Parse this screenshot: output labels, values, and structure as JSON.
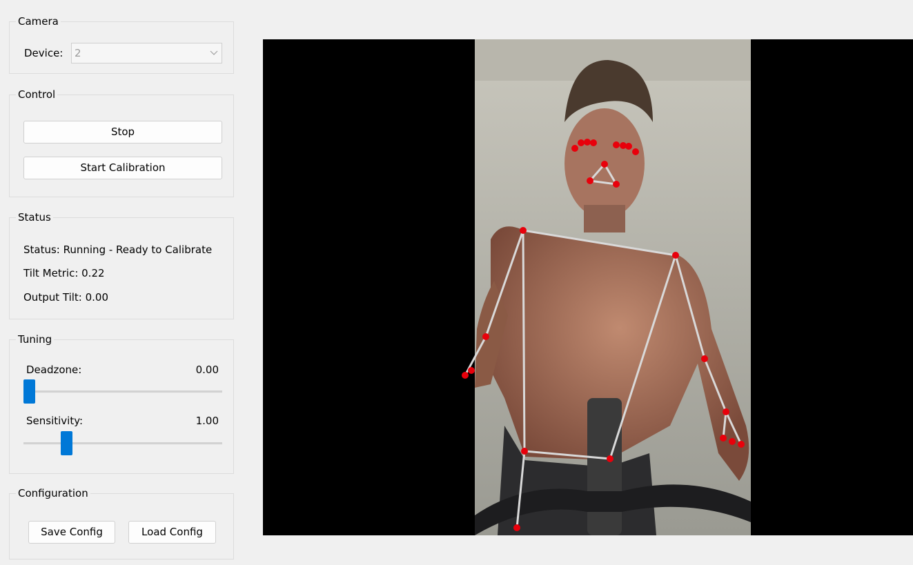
{
  "camera": {
    "group_title": "Camera",
    "device_label": "Device:",
    "device_value": "2"
  },
  "control": {
    "group_title": "Control",
    "stop_label": "Stop",
    "calibration_label": "Start Calibration"
  },
  "status": {
    "group_title": "Status",
    "status_text": "Status: Running - Ready to Calibrate",
    "tilt_metric_text": "Tilt Metric: 0.22",
    "output_tilt_text": "Output Tilt: 0.00"
  },
  "tuning": {
    "group_title": "Tuning",
    "deadzone_label": "Deadzone:",
    "deadzone_value": "0.00",
    "deadzone_level": 0.0,
    "sensitivity_label": "Sensitivity:",
    "sensitivity_value": "1.00",
    "sensitivity_level": 0.2
  },
  "configuration": {
    "group_title": "Configuration",
    "save_label": "Save Config",
    "load_label": "Load Config"
  },
  "colors": {
    "accent": "#0078d7",
    "keypoint": "#e8000b",
    "skeleton": "#d9d9d9",
    "video_background": "#000000"
  },
  "icons": {
    "combo_arrow": "chevron-down-icon"
  }
}
